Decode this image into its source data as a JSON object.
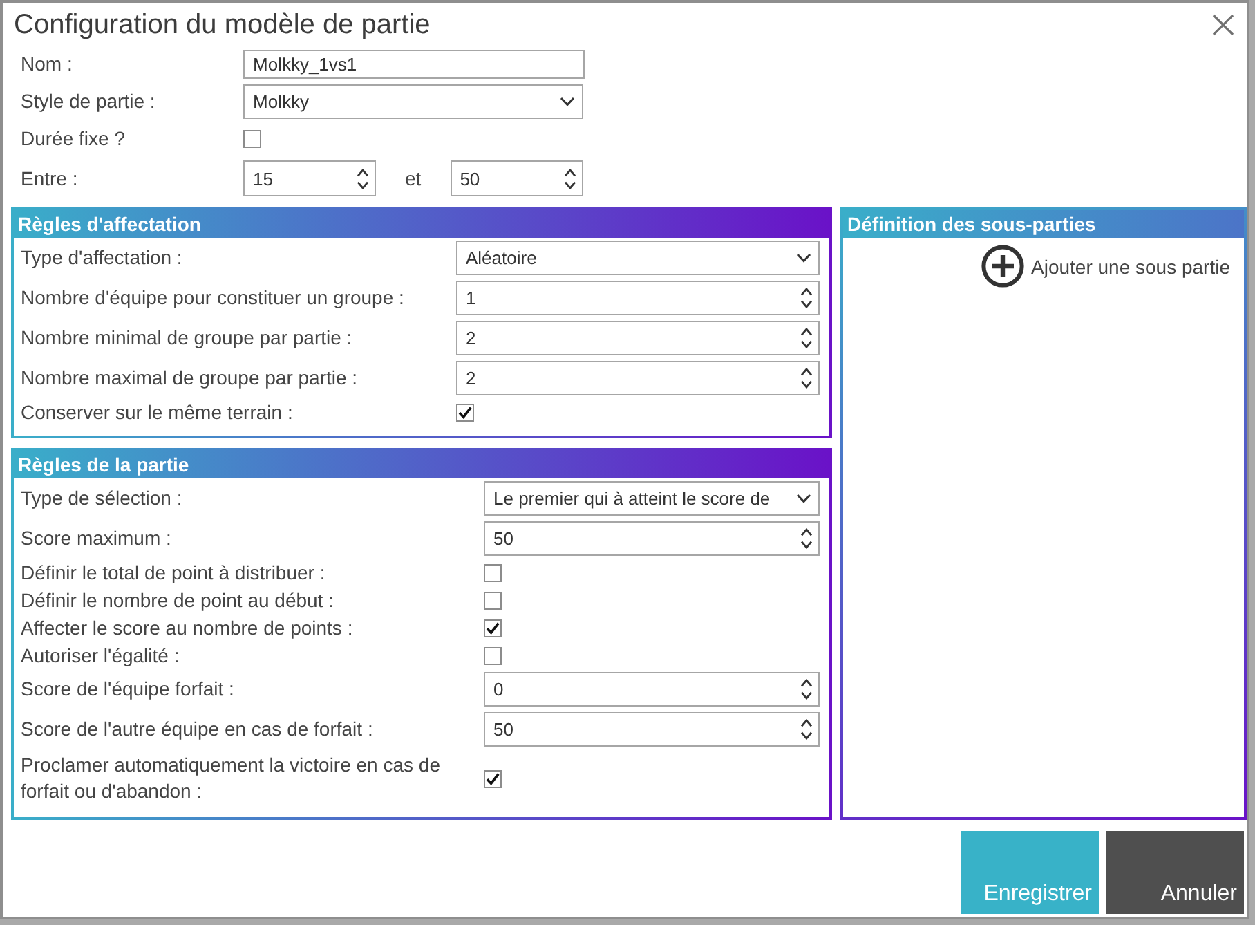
{
  "dialog": {
    "title": "Configuration du modèle de partie"
  },
  "general_fields": [
    {
      "kind": "text",
      "label": "Nom :",
      "value": "Molkky_1vs1"
    },
    {
      "kind": "select",
      "label": "Style de partie :",
      "value": "Molkky"
    },
    {
      "kind": "checkbox",
      "label": "Durée fixe ?",
      "checked": false
    },
    {
      "kind": "range",
      "label": "Entre :",
      "from": "15",
      "separator": "et",
      "to": "50"
    }
  ],
  "sections": [
    {
      "title": "Règles d'affectation",
      "fields": [
        {
          "kind": "select",
          "label": "Type d'affectation :",
          "value": "Aléatoire"
        },
        {
          "kind": "number",
          "label": "Nombre d'équipe pour constituer un groupe :",
          "value": "1"
        },
        {
          "kind": "number",
          "label": "Nombre minimal de groupe par partie :",
          "value": "2"
        },
        {
          "kind": "number",
          "label": "Nombre maximal de groupe par partie :",
          "value": "2"
        },
        {
          "kind": "checkbox",
          "label": "Conserver sur le même terrain :",
          "checked": true
        }
      ]
    },
    {
      "title": "Règles de la partie",
      "fields": [
        {
          "kind": "select",
          "label": "Type de sélection :",
          "value": "Le premier qui à atteint le score de"
        },
        {
          "kind": "number",
          "label": "Score maximum :",
          "value": "50"
        },
        {
          "kind": "checkbox",
          "label": "Définir le total de point à distribuer :",
          "checked": false
        },
        {
          "kind": "checkbox",
          "label": "Définir le nombre de point au début :",
          "checked": false
        },
        {
          "kind": "checkbox",
          "label": "Affecter le score au nombre de points :",
          "checked": true
        },
        {
          "kind": "checkbox",
          "label": "Autoriser l'égalité :",
          "checked": false
        },
        {
          "kind": "number",
          "label": "Score de l'équipe forfait :",
          "value": "0"
        },
        {
          "kind": "number",
          "label": "Score de l'autre équipe en cas de forfait :",
          "value": "50"
        },
        {
          "kind": "checkbox",
          "label": "Proclamer automatiquement la victoire en cas de forfait ou d'abandon :",
          "checked": true
        }
      ]
    }
  ],
  "subparts_panel": {
    "title": "Définition des sous-parties",
    "add_button": "Ajouter une sous partie"
  },
  "buttons": [
    {
      "kind": "primary",
      "label": "Enregistrer"
    },
    {
      "kind": "secondary",
      "label": "Annuler"
    }
  ]
}
